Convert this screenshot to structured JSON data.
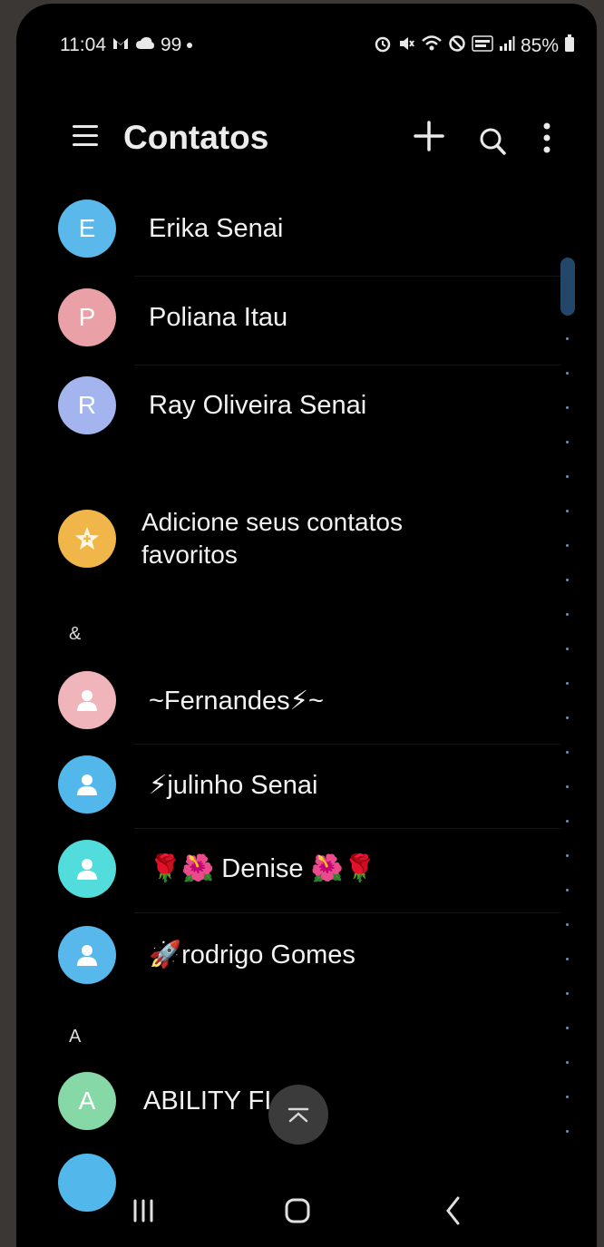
{
  "status_bar": {
    "time": "11:04",
    "left_extra": "99",
    "battery": "85%"
  },
  "header": {
    "title": "Contatos"
  },
  "contacts_top": [
    {
      "initial": "E",
      "name": "Erika Senai",
      "color": "#5ab8ea"
    },
    {
      "initial": "P",
      "name": "Poliana Itau",
      "color": "#e9a0a6"
    },
    {
      "initial": "R",
      "name": "Ray Oliveira Senai",
      "color": "#a3b4ef"
    }
  ],
  "favorites": {
    "label_line1": "Adicione seus contatos",
    "label_line2": "favoritos",
    "color": "#f1b64a"
  },
  "section_amp": "&",
  "contacts_amp": [
    {
      "name": "~Fernandes⚡~",
      "color": "#f0b5ba"
    },
    {
      "name": "⚡julinho Senai",
      "color": "#52b8ec"
    },
    {
      "name": "🌹🌺 Denise 🌺🌹",
      "color": "#52dcdc"
    },
    {
      "name": "🚀rodrigo Gomes",
      "color": "#58b8ec"
    }
  ],
  "section_a": "A",
  "contacts_a": [
    {
      "initial": "A",
      "name": "ABILITY FI",
      "color": "#86d9a6"
    }
  ],
  "icons": {
    "menu": "hamburger-icon",
    "add": "plus-icon",
    "search": "search-icon",
    "more": "more-vertical-icon",
    "scroll_top": "chevron-up-icon",
    "recents": "recents-icon",
    "home": "home-icon",
    "back": "back-icon"
  }
}
